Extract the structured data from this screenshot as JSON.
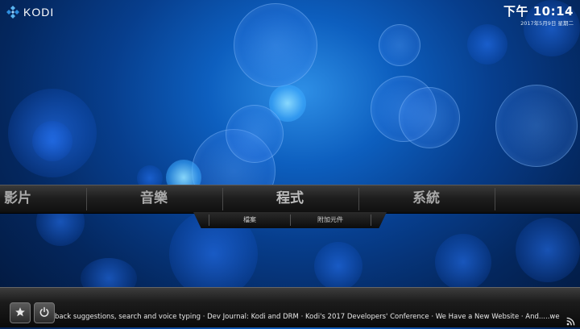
{
  "app": {
    "logo_text": "KODI",
    "logo_icon": "kodi-logo-icon"
  },
  "clock": {
    "time": "下午 10:14",
    "date": "2017年5月9日 星期二"
  },
  "main_menu": {
    "items": [
      {
        "label": "影片"
      },
      {
        "label": "音樂"
      },
      {
        "label": "程式"
      },
      {
        "label": "系統"
      }
    ]
  },
  "submenu": {
    "items": [
      {
        "label": "檔案"
      },
      {
        "label": "附加元件"
      }
    ]
  },
  "footer": {
    "favourites_icon": "star-icon",
    "power_icon": "power-icon",
    "rss_icon": "rss-icon",
    "ticker": "back suggestions, search and voice typing · Dev Journal: Kodi and DRM · Kodi's 2017 Developers' Conference · We Have a New Website · And.....we"
  },
  "colors": {
    "background_accent": "#0d5fbf",
    "menu_text": "#a9a9a9"
  }
}
